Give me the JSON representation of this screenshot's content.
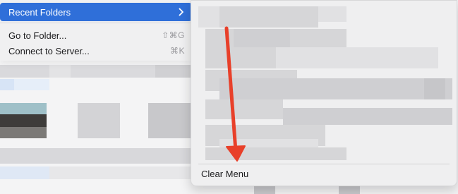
{
  "menu": {
    "items": [
      {
        "label": "Recent Folders",
        "shortcut": "",
        "has_submenu": true,
        "highlighted": true
      },
      {
        "label": "Go to Folder...",
        "shortcut": "⇧⌘G"
      },
      {
        "label": "Connect to Server...",
        "shortcut": "⌘K"
      }
    ]
  },
  "submenu": {
    "clear_label": "Clear Menu"
  },
  "colors": {
    "highlight": "#2f6fd9",
    "arrow": "#e8402a"
  },
  "icons": {
    "submenu_chevron": "chevron-right-icon",
    "annotation_arrow": "red-arrow-annotation"
  }
}
